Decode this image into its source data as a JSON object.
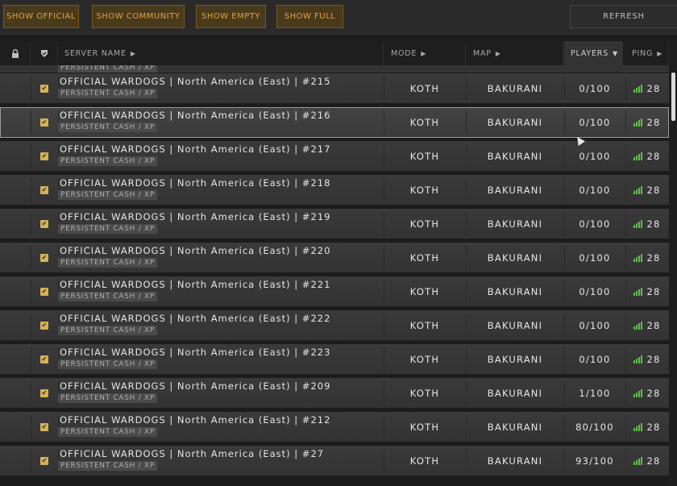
{
  "filters": [
    {
      "label": "SHOW OFFICIAL"
    },
    {
      "label": "SHOW COMMUNITY"
    },
    {
      "label": "SHOW EMPTY"
    },
    {
      "label": "SHOW FULL"
    }
  ],
  "refresh_label": "REFRESH",
  "columns": {
    "lock_icon": "lock-icon",
    "official_icon": "shield-check-icon",
    "server_name": "SERVER NAME",
    "mode": "MODE",
    "map": "MAP",
    "players": "PLAYERS",
    "ping": "PING",
    "sorted_by": "PLAYERS"
  },
  "partial_row_tag": "PERSISTENT CASH / XP",
  "rows": [
    {
      "name": "OFFICIAL WARDOGS | North America (East) | #215",
      "tag": "PERSISTENT CASH / XP",
      "mode": "KOTH",
      "map": "BAKURANI",
      "players": "0/100",
      "ping": "28",
      "selected": false
    },
    {
      "name": "OFFICIAL WARDOGS | North America (East) | #216",
      "tag": "PERSISTENT CASH / XP",
      "mode": "KOTH",
      "map": "BAKURANI",
      "players": "0/100",
      "ping": "28",
      "selected": true
    },
    {
      "name": "OFFICIAL WARDOGS | North America (East) | #217",
      "tag": "PERSISTENT CASH / XP",
      "mode": "KOTH",
      "map": "BAKURANI",
      "players": "0/100",
      "ping": "28",
      "selected": false
    },
    {
      "name": "OFFICIAL WARDOGS | North America (East) | #218",
      "tag": "PERSISTENT CASH / XP",
      "mode": "KOTH",
      "map": "BAKURANI",
      "players": "0/100",
      "ping": "28",
      "selected": false
    },
    {
      "name": "OFFICIAL WARDOGS | North America (East) | #219",
      "tag": "PERSISTENT CASH / XP",
      "mode": "KOTH",
      "map": "BAKURANI",
      "players": "0/100",
      "ping": "28",
      "selected": false
    },
    {
      "name": "OFFICIAL WARDOGS | North America (East) | #220",
      "tag": "PERSISTENT CASH / XP",
      "mode": "KOTH",
      "map": "BAKURANI",
      "players": "0/100",
      "ping": "28",
      "selected": false
    },
    {
      "name": "OFFICIAL WARDOGS | North America (East) | #221",
      "tag": "PERSISTENT CASH / XP",
      "mode": "KOTH",
      "map": "BAKURANI",
      "players": "0/100",
      "ping": "28",
      "selected": false
    },
    {
      "name": "OFFICIAL WARDOGS | North America (East) | #222",
      "tag": "PERSISTENT CASH / XP",
      "mode": "KOTH",
      "map": "BAKURANI",
      "players": "0/100",
      "ping": "28",
      "selected": false
    },
    {
      "name": "OFFICIAL WARDOGS | North America (East) | #223",
      "tag": "PERSISTENT CASH / XP",
      "mode": "KOTH",
      "map": "BAKURANI",
      "players": "0/100",
      "ping": "28",
      "selected": false
    },
    {
      "name": "OFFICIAL WARDOGS | North America (East) | #209",
      "tag": "PERSISTENT CASH / XP",
      "mode": "KOTH",
      "map": "BAKURANI",
      "players": "1/100",
      "ping": "28",
      "selected": false
    },
    {
      "name": "OFFICIAL WARDOGS | North America (East) | #212",
      "tag": "PERSISTENT CASH / XP",
      "mode": "KOTH",
      "map": "BAKURANI",
      "players": "80/100",
      "ping": "28",
      "selected": false
    },
    {
      "name": "OFFICIAL WARDOGS | North America (East) | #27",
      "tag": "PERSISTENT CASH / XP",
      "mode": "KOTH",
      "map": "BAKURANI",
      "players": "93/100",
      "ping": "28",
      "selected": false
    }
  ],
  "colors": {
    "accent": "#e0a53a",
    "ping_good": "#5fc04a"
  }
}
